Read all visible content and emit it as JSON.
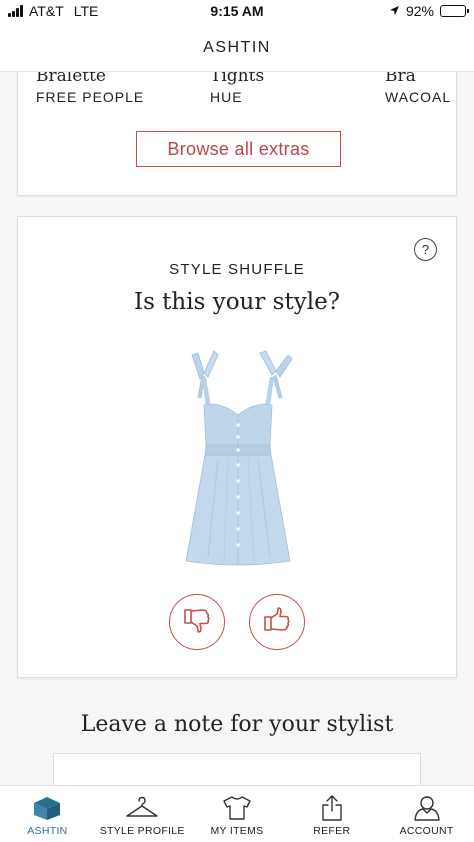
{
  "status_bar": {
    "carrier": "AT&T",
    "network": "LTE",
    "time": "9:15 AM",
    "battery": "92%",
    "battery_level": 0.92,
    "icons": [
      "signal-icon",
      "location-arrow-icon",
      "battery-icon"
    ]
  },
  "header": {
    "title": "ASHTIN"
  },
  "extras": {
    "items": [
      {
        "name": "Bralette",
        "brand": "FREE PEOPLE"
      },
      {
        "name": "Tights",
        "brand": "HUE"
      },
      {
        "name": "Bra",
        "brand": "WACOAL"
      }
    ],
    "browse_label": "Browse all extras"
  },
  "style_shuffle": {
    "label": "STYLE SHUFFLE",
    "question": "Is this your style?",
    "help_label": "?",
    "item_icon": "dress-image",
    "dislike_icon": "thumbs-down-icon",
    "like_icon": "thumbs-up-icon"
  },
  "note": {
    "title": "Leave a note for your stylist",
    "value": ""
  },
  "tab_bar": {
    "tabs": [
      {
        "label": "ASHTIN",
        "icon": "box-icon",
        "active": true
      },
      {
        "label": "STYLE PROFILE",
        "icon": "hanger-icon",
        "active": false
      },
      {
        "label": "MY ITEMS",
        "icon": "shirt-icon",
        "active": false
      },
      {
        "label": "REFER",
        "icon": "share-icon",
        "active": false
      },
      {
        "label": "ACCOUNT",
        "icon": "person-icon",
        "active": false
      }
    ]
  },
  "colors": {
    "accent_red": "#c0514f",
    "active_tab": "#2b6f8e",
    "dress_blue": "#b9d3e8"
  }
}
